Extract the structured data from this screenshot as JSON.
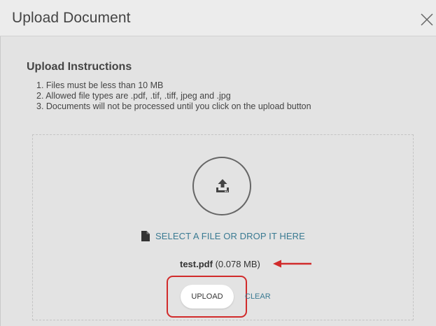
{
  "dialog": {
    "title": "Upload Document",
    "close_icon": "close-icon"
  },
  "instructions": {
    "title": "Upload Instructions",
    "items": [
      "1. Files must be less than 10 MB",
      "2. Allowed file types are .pdf, .tif, .tiff, jpeg and .jpg",
      "3. Documents will not be processed until you click on the upload button"
    ]
  },
  "dropzone": {
    "upload_icon": "upload-icon",
    "file_icon": "file-icon",
    "select_label": "SELECT A FILE OR DROP IT HERE"
  },
  "selected_file": {
    "name": "test.pdf",
    "size": "(0.078 MB)"
  },
  "actions": {
    "upload_label": "UPLOAD",
    "clear_label": "CLEAR"
  },
  "colors": {
    "link": "#3a7a92",
    "highlight": "#d12b2b",
    "background": "#e3e3e3"
  }
}
